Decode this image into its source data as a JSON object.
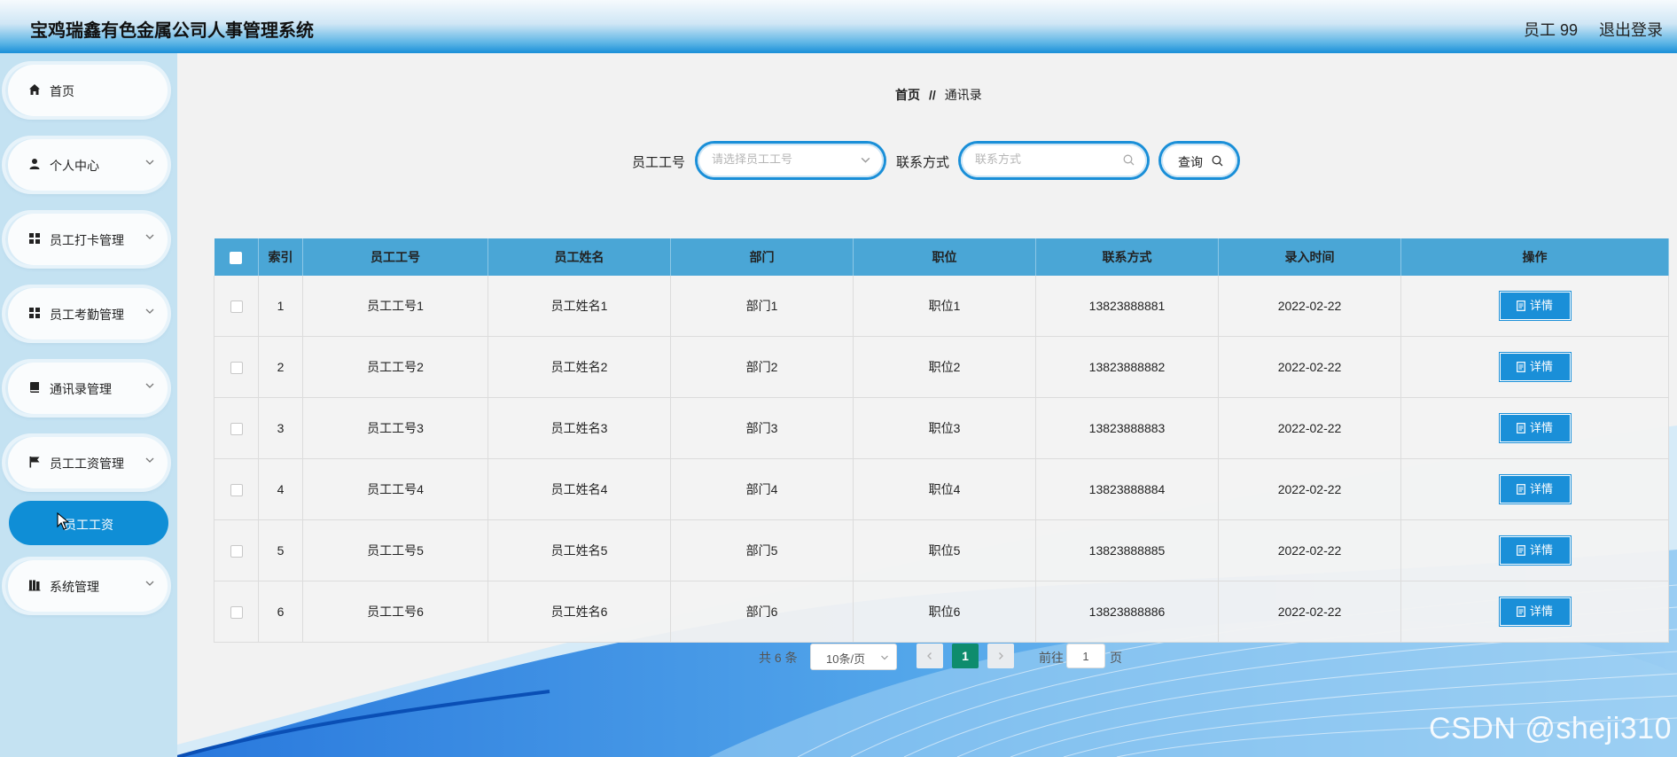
{
  "header": {
    "title": "宝鸡瑞鑫有色金属公司人事管理系统",
    "user": "员工 99",
    "logout": "退出登录"
  },
  "sidebar": {
    "items": [
      {
        "label": "首页",
        "icon": "home-icon"
      },
      {
        "label": "个人中心",
        "icon": "user-icon"
      },
      {
        "label": "员工打卡管理",
        "icon": "grid-icon"
      },
      {
        "label": "员工考勤管理",
        "icon": "grid-icon"
      },
      {
        "label": "通讯录管理",
        "icon": "book-icon"
      },
      {
        "label": "员工工资管理",
        "icon": "flag-icon"
      },
      {
        "label": "系统管理",
        "icon": "library-icon"
      }
    ],
    "active_sub": "员工工资"
  },
  "breadcrumb": {
    "home": "首页",
    "separator": "//",
    "current": "通讯录"
  },
  "search": {
    "emp_no_label": "员工工号",
    "emp_no_placeholder": "请选择员工工号",
    "contact_label": "联系方式",
    "contact_placeholder": "联系方式",
    "query_label": "查询"
  },
  "table": {
    "headers": [
      "索引",
      "员工工号",
      "员工姓名",
      "部门",
      "职位",
      "联系方式",
      "录入时间",
      "操作"
    ],
    "action_label": "详情",
    "rows": [
      {
        "index": "1",
        "emp_no": "员工工号1",
        "name": "员工姓名1",
        "dept": "部门1",
        "position": "职位1",
        "contact": "13823888881",
        "time": "2022-02-22"
      },
      {
        "index": "2",
        "emp_no": "员工工号2",
        "name": "员工姓名2",
        "dept": "部门2",
        "position": "职位2",
        "contact": "13823888882",
        "time": "2022-02-22"
      },
      {
        "index": "3",
        "emp_no": "员工工号3",
        "name": "员工姓名3",
        "dept": "部门3",
        "position": "职位3",
        "contact": "13823888883",
        "time": "2022-02-22"
      },
      {
        "index": "4",
        "emp_no": "员工工号4",
        "name": "员工姓名4",
        "dept": "部门4",
        "position": "职位4",
        "contact": "13823888884",
        "time": "2022-02-22"
      },
      {
        "index": "5",
        "emp_no": "员工工号5",
        "name": "员工姓名5",
        "dept": "部门5",
        "position": "职位5",
        "contact": "13823888885",
        "time": "2022-02-22"
      },
      {
        "index": "6",
        "emp_no": "员工工号6",
        "name": "员工姓名6",
        "dept": "部门6",
        "position": "职位6",
        "contact": "13823888886",
        "time": "2022-02-22"
      }
    ]
  },
  "pagination": {
    "total": "共 6 条",
    "page_size": "10条/页",
    "current_page": "1",
    "goto_label": "前往",
    "goto_value": "1",
    "page_suffix": "页"
  },
  "watermark": "CSDN @sheji310",
  "colors": {
    "accent": "#1a8fd8",
    "table_header": "#4aa6d6",
    "active_page": "#0e8c6d"
  }
}
